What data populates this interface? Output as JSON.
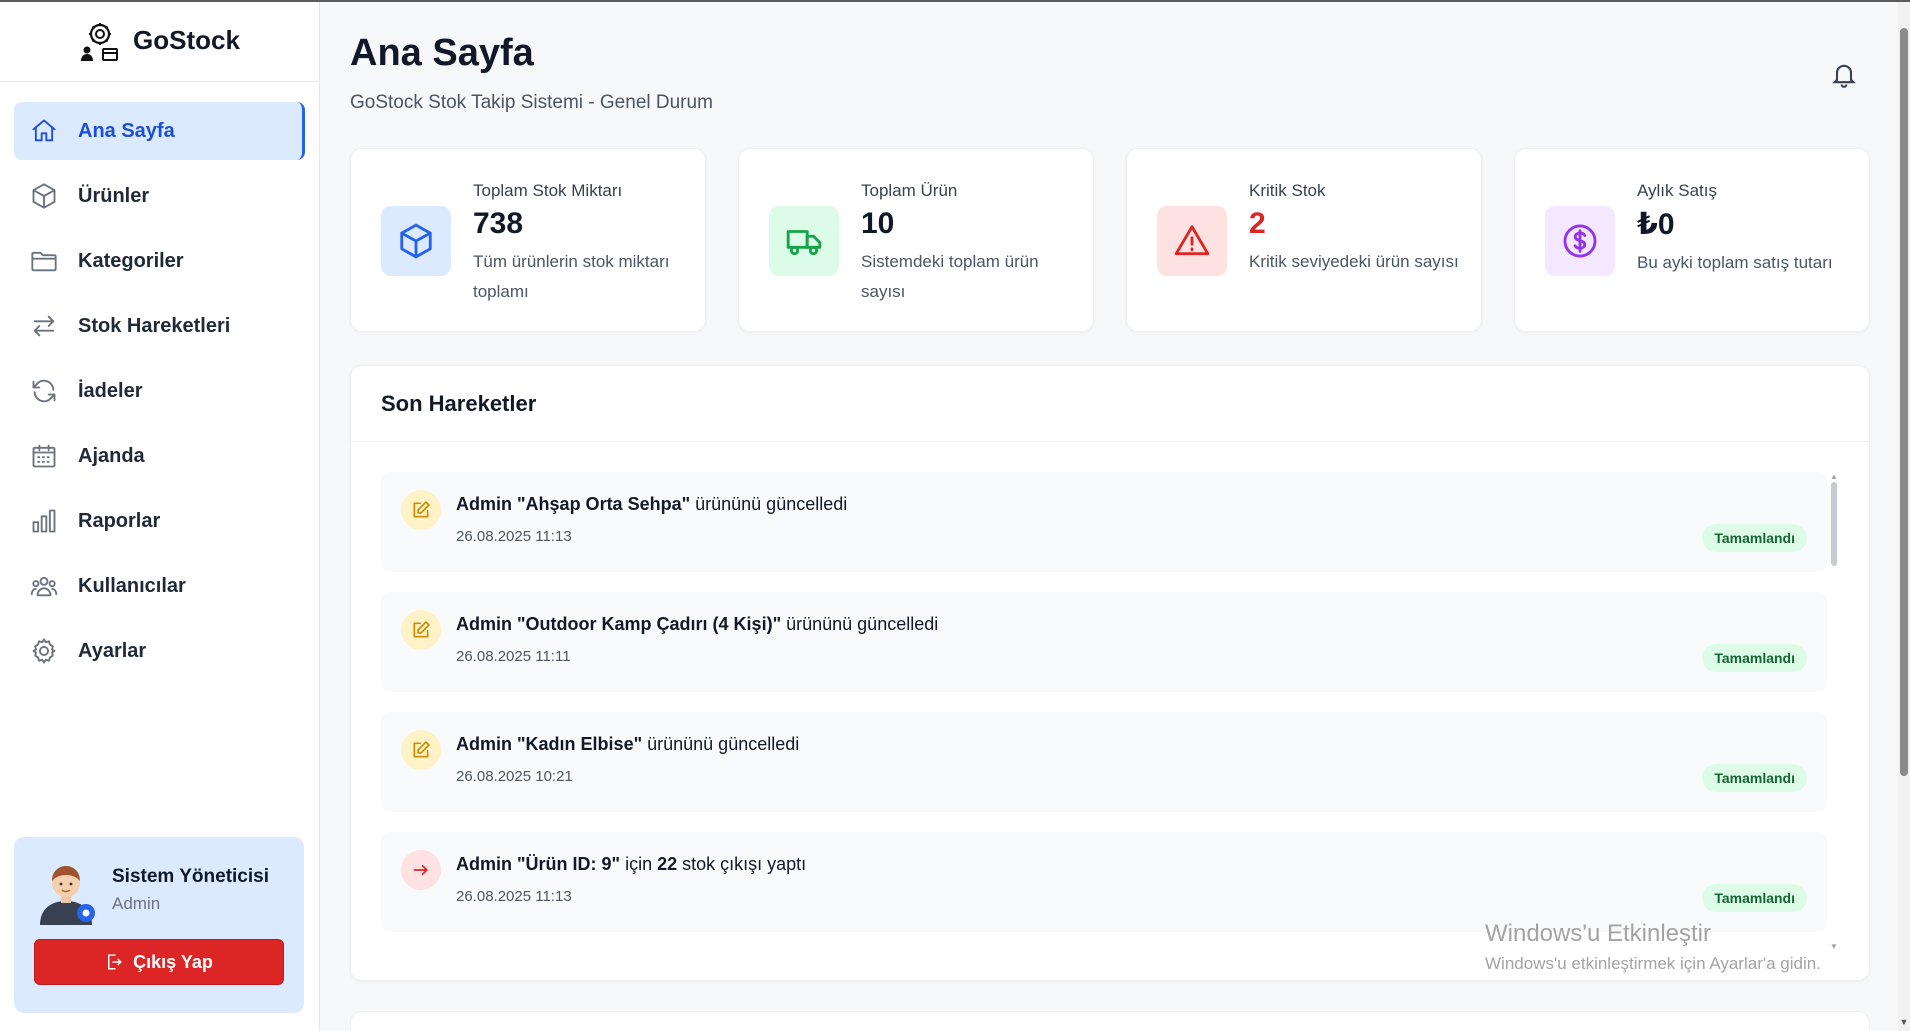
{
  "brand": {
    "name": "GoStock"
  },
  "sidebar": {
    "items": [
      {
        "label": "Ana Sayfa",
        "icon": "home-icon",
        "active": true
      },
      {
        "label": "Ürünler",
        "icon": "box-icon"
      },
      {
        "label": "Kategoriler",
        "icon": "folder-icon"
      },
      {
        "label": "Stok Hareketleri",
        "icon": "transfer-icon"
      },
      {
        "label": "İadeler",
        "icon": "refresh-icon"
      },
      {
        "label": "Ajanda",
        "icon": "calendar-icon"
      },
      {
        "label": "Raporlar",
        "icon": "bar-chart-icon"
      },
      {
        "label": "Kullanıcılar",
        "icon": "users-icon"
      },
      {
        "label": "Ayarlar",
        "icon": "gear-icon"
      }
    ],
    "user": {
      "name": "Sistem Yöneticisi",
      "role": "Admin",
      "logout_label": "Çıkış Yap"
    }
  },
  "header": {
    "title": "Ana Sayfa",
    "subtitle": "GoStock Stok Takip Sistemi - Genel Durum"
  },
  "stats": [
    {
      "label": "Toplam Stok Miktarı",
      "value": "738",
      "desc": "Tüm ürünlerin stok miktarı toplamı",
      "icon": "cube-icon",
      "color": "#2563eb",
      "bg": "#dbeafe"
    },
    {
      "label": "Toplam Ürün",
      "value": "10",
      "desc": "Sistemdeki toplam ürün sayısı",
      "icon": "truck-icon",
      "color": "#16a34a",
      "bg": "#dcfce7"
    },
    {
      "label": "Kritik Stok",
      "value": "2",
      "desc": "Kritik seviyedeki ürün sayısı",
      "icon": "warning-icon",
      "color": "#dc2626",
      "bg": "#fee2e2"
    },
    {
      "label": "Aylık Satış",
      "value": "₺0",
      "desc": "Bu ayki toplam satış tutarı",
      "icon": "dollar-icon",
      "color": "#9333ea",
      "bg": "#f3e8ff"
    }
  ],
  "activity": {
    "title": "Son Hareketler",
    "items": [
      {
        "actor": "Admin",
        "subject": "\"Ahşap Orta Sehpa\"",
        "action": " ürününü güncelledi",
        "time": "26.08.2025 11:13",
        "status": "Tamamlandı",
        "icon": "edit-icon"
      },
      {
        "actor": "Admin",
        "subject": "\"Outdoor Kamp Çadırı (4 Kişi)\"",
        "action": " ürününü güncelledi",
        "time": "26.08.2025 11:11",
        "status": "Tamamlandı",
        "icon": "edit-icon"
      },
      {
        "actor": "Admin",
        "subject": "\"Kadın Elbise\"",
        "action": " ürününü güncelledi",
        "time": "26.08.2025 10:21",
        "status": "Tamamlandı",
        "icon": "edit-icon"
      },
      {
        "actor": "Admin",
        "subject": "\"Ürün ID: 9\"",
        "action": " için ",
        "qty": "22",
        "action2": " stok çıkışı yaptı",
        "time": "26.08.2025 11:13",
        "status": "Tamamlandı",
        "icon": "arrow-right-icon"
      }
    ]
  },
  "watermark": {
    "line1": "Windows'u Etkinleştir",
    "line2": "Windows'u etkinleştirmek için Ayarlar'a gidin."
  }
}
